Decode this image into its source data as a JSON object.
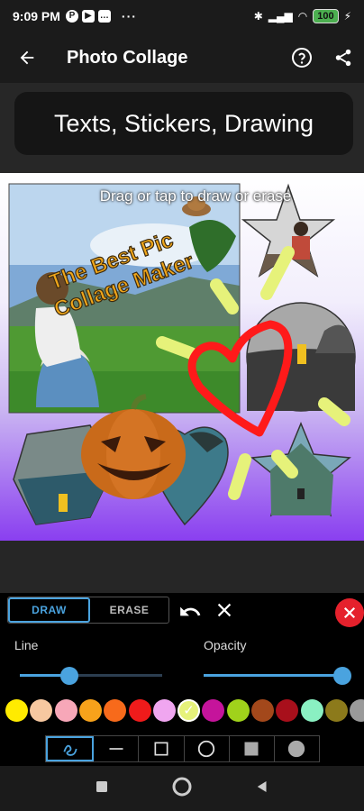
{
  "status": {
    "time": "9:09 PM",
    "dots": "···",
    "battery": "100"
  },
  "appbar": {
    "title": "Photo Collage"
  },
  "banner": {
    "text": "Texts, Stickers, Drawing"
  },
  "canvas": {
    "hint": "Drag or tap to draw or erase",
    "sticker_text_line1": "The Best Pic",
    "sticker_text_line2": "Collage Maker"
  },
  "panel": {
    "draw_label": "DRAW",
    "erase_label": "ERASE",
    "line_label": "Line",
    "opacity_label": "Opacity",
    "line_value": 0.35,
    "opacity_value": 1.0,
    "colors": [
      "#ffeb00",
      "#f7c8a0",
      "#f7a7b8",
      "#f7a21b",
      "#f76a1b",
      "#ef1b1b",
      "#f0a6f0",
      "#e6f27a",
      "#c5149b",
      "#a0d21b",
      "#a3481b",
      "#a80f1b",
      "#8af0c2",
      "#8c7a1b",
      "#9a9a9a"
    ],
    "selected_color": "#e6f27a",
    "tools": [
      "freehand",
      "line",
      "rectangle",
      "circle",
      "filled-rectangle",
      "filled-circle"
    ]
  },
  "colors": {
    "accent": "#4aa3df",
    "danger": "#e5212c"
  }
}
